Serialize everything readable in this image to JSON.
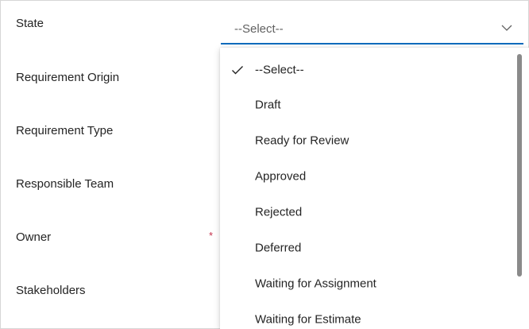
{
  "form": {
    "fields": [
      {
        "label": "State"
      },
      {
        "label": "Requirement Origin"
      },
      {
        "label": "Requirement Type"
      },
      {
        "label": "Responsible Team"
      },
      {
        "label": "Owner",
        "required_mark": "*"
      },
      {
        "label": "Stakeholders"
      }
    ]
  },
  "state_select": {
    "value": "--Select--",
    "icon": "chevron-down-icon"
  },
  "dropdown": {
    "options": [
      {
        "label": "--Select--",
        "selected": true
      },
      {
        "label": "Draft"
      },
      {
        "label": "Ready for Review"
      },
      {
        "label": "Approved"
      },
      {
        "label": "Rejected"
      },
      {
        "label": "Deferred"
      },
      {
        "label": "Waiting for Assignment"
      },
      {
        "label": "Waiting for Estimate"
      }
    ]
  },
  "colors": {
    "accent": "#0f6cbd",
    "required": "#c4314b",
    "placeholder_text": "#616161"
  }
}
